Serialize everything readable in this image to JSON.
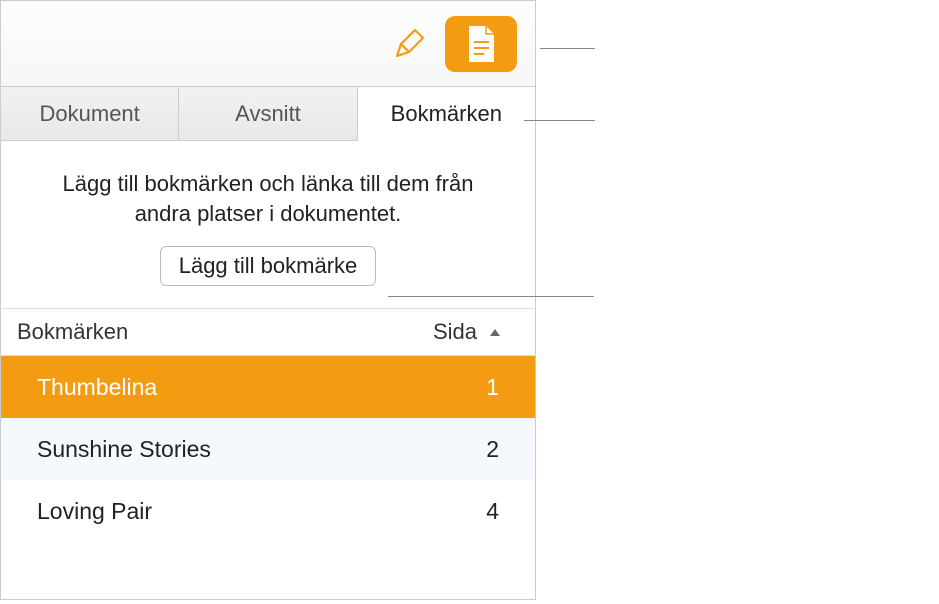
{
  "tabs": {
    "document": "Dokument",
    "section": "Avsnitt",
    "bookmarks": "Bokmärken"
  },
  "instruction": "Lägg till bokmärken och länka till dem från andra platser i dokumentet.",
  "addButton": "Lägg till bokmärke",
  "listHeader": {
    "name": "Bokmärken",
    "page": "Sida"
  },
  "bookmarks": [
    {
      "name": "Thumbelina",
      "page": "1"
    },
    {
      "name": "Sunshine Stories",
      "page": "2"
    },
    {
      "name": "Loving Pair",
      "page": "4"
    }
  ]
}
